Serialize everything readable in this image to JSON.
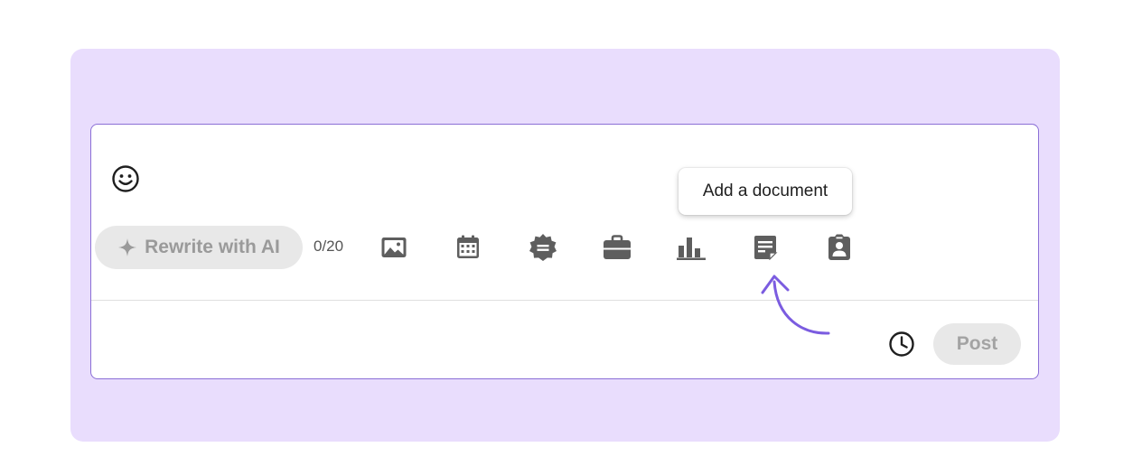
{
  "composer": {
    "emoji_icon": "smiley-face-icon",
    "tooltip": "Add a document",
    "rewrite_button": {
      "label": "Rewrite with AI",
      "icon": "sparkle-icon"
    },
    "char_counter": "0/20",
    "toolbar": [
      {
        "name": "add-photo",
        "icon": "image-icon"
      },
      {
        "name": "create-event",
        "icon": "calendar-icon"
      },
      {
        "name": "celebrate-occasion",
        "icon": "badge-icon"
      },
      {
        "name": "share-job",
        "icon": "briefcase-icon"
      },
      {
        "name": "create-poll",
        "icon": "bar-chart-icon"
      },
      {
        "name": "add-document",
        "icon": "document-icon"
      },
      {
        "name": "find-expert",
        "icon": "id-badge-icon"
      }
    ],
    "schedule_icon": "clock-icon",
    "post_button": "Post"
  },
  "colors": {
    "backdrop": "#e9ddfd",
    "composer_border": "#8b6fd6",
    "arrow": "#7b5ce0",
    "icon": "#5e5e5e",
    "disabled_button_bg": "#e8e8e8",
    "disabled_button_text": "#9a9a9a"
  }
}
